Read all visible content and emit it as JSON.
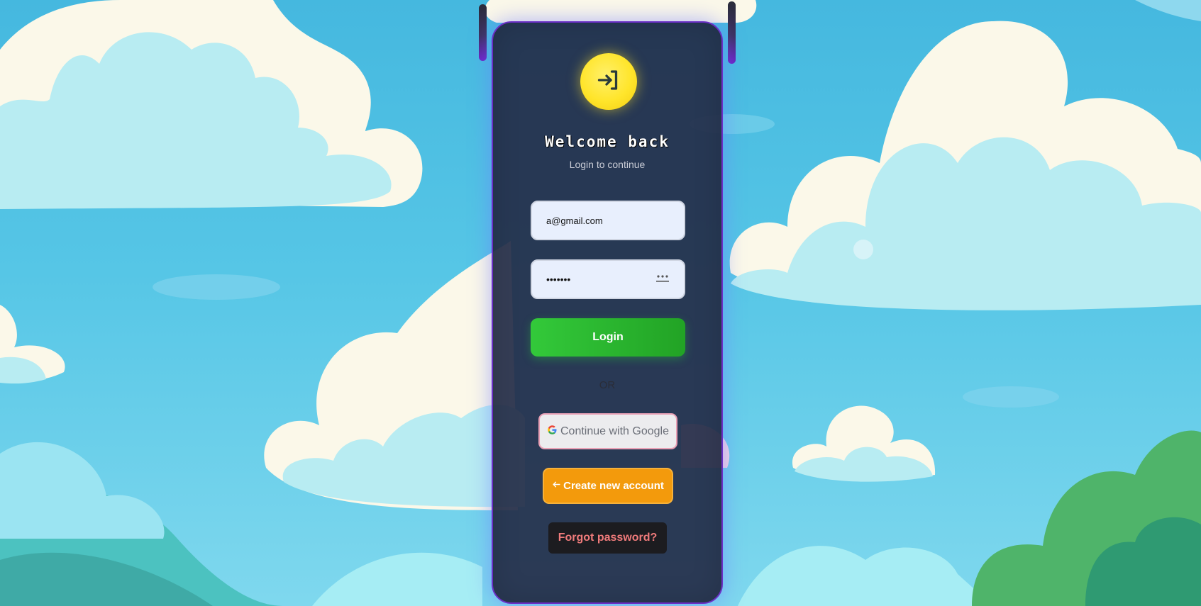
{
  "login_card": {
    "title": "Welcome back",
    "subtitle": "Login to continue",
    "email": {
      "value": "a@gmail.com"
    },
    "password": {
      "value": "•••••••"
    },
    "login_label": "Login",
    "divider_text": "OR",
    "google_label": "Continue with Google",
    "create_account_label": "Create new account",
    "forgot_password_label": "Forgot password?"
  },
  "icons": {
    "logo": "login-arrow-icon",
    "password_toggle": "password-dots-icon",
    "google": "google-g-icon",
    "create_account": "arrow-left-icon"
  },
  "colors": {
    "card_bg": "#242c48",
    "card_border": "#6b2fc6",
    "logo_yellow": "#ffe52b",
    "login_green": "#2bb82f",
    "google_border": "#e9a0b5",
    "create_orange": "#f39a0c",
    "forgot_text": "#f07b7b",
    "sky_blue": "#4cbfe3"
  }
}
